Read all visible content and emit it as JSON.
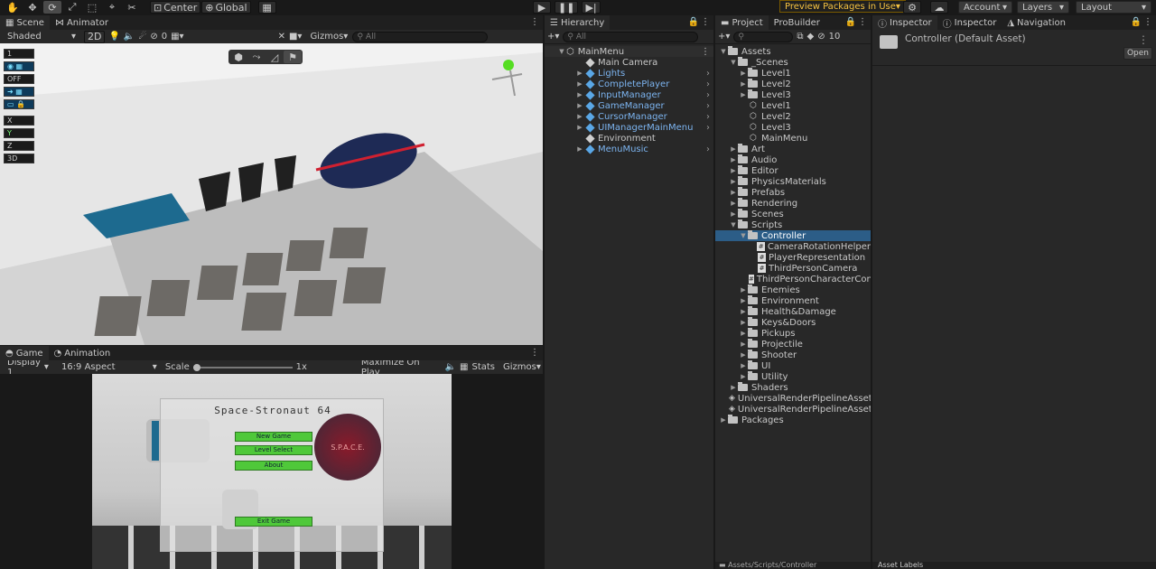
{
  "toolbar": {
    "center": "Center",
    "global": "Global",
    "preview": "Preview Packages in Use",
    "account": "Account",
    "layers": "Layers",
    "layout": "Layout"
  },
  "scene": {
    "tab_scene": "Scene",
    "tab_animator": "Animator",
    "shading": "Shaded",
    "mode2d": "2D",
    "hidden_count": "0",
    "gizmos": "Gizmos",
    "search_placeholder": "All",
    "overlays": [
      "1",
      "",
      "OFF",
      "",
      "",
      "X",
      "Y",
      "Z",
      "3D"
    ]
  },
  "game": {
    "tab_game": "Game",
    "tab_animation": "Animation",
    "display": "Display 1",
    "aspect": "16:9 Aspect",
    "scale_label": "Scale",
    "scale_value": "1x",
    "maximize": "Maximize On Play",
    "stats": "Stats",
    "gizmos": "Gizmos",
    "menu_title": "Space-Stronaut 64",
    "buttons": [
      "New Game",
      "Level Select",
      "About",
      "Exit Game"
    ],
    "logo_text": "S.P.A.C.E."
  },
  "hierarchy": {
    "tab": "Hierarchy",
    "search_placeholder": "All",
    "root": "MainMenu",
    "items": [
      {
        "name": "Main Camera",
        "blue": false,
        "arrow": false
      },
      {
        "name": "Lights",
        "blue": true,
        "arrow": true
      },
      {
        "name": "CompletePlayer",
        "blue": true,
        "arrow": true
      },
      {
        "name": "InputManager",
        "blue": true,
        "arrow": true
      },
      {
        "name": "GameManager",
        "blue": true,
        "arrow": true
      },
      {
        "name": "CursorManager",
        "blue": true,
        "arrow": true
      },
      {
        "name": "UIManagerMainMenu",
        "blue": true,
        "arrow": true
      },
      {
        "name": "Environment",
        "blue": false,
        "arrow": false
      },
      {
        "name": "MenuMusic",
        "blue": true,
        "arrow": true
      }
    ]
  },
  "project": {
    "tab_project": "Project",
    "tab_probuilder": "ProBuilder",
    "hidden_count": "10",
    "breadcrumb": "Assets/Scripts/Controller",
    "tree": [
      {
        "name": "Assets",
        "depth": 0,
        "type": "folder",
        "arrow": "open"
      },
      {
        "name": "_Scenes",
        "depth": 1,
        "type": "folder",
        "arrow": "open"
      },
      {
        "name": "Level1",
        "depth": 2,
        "type": "folder",
        "arrow": "closed"
      },
      {
        "name": "Level2",
        "depth": 2,
        "type": "folder",
        "arrow": "closed"
      },
      {
        "name": "Level3",
        "depth": 2,
        "type": "folder",
        "arrow": "closed"
      },
      {
        "name": "Level1",
        "depth": 2,
        "type": "scene",
        "arrow": "none"
      },
      {
        "name": "Level2",
        "depth": 2,
        "type": "scene",
        "arrow": "none"
      },
      {
        "name": "Level3",
        "depth": 2,
        "type": "scene",
        "arrow": "none"
      },
      {
        "name": "MainMenu",
        "depth": 2,
        "type": "scene",
        "arrow": "none"
      },
      {
        "name": "Art",
        "depth": 1,
        "type": "folder",
        "arrow": "closed"
      },
      {
        "name": "Audio",
        "depth": 1,
        "type": "folder",
        "arrow": "closed"
      },
      {
        "name": "Editor",
        "depth": 1,
        "type": "folder",
        "arrow": "closed"
      },
      {
        "name": "PhysicsMaterials",
        "depth": 1,
        "type": "folder",
        "arrow": "closed"
      },
      {
        "name": "Prefabs",
        "depth": 1,
        "type": "folder",
        "arrow": "closed"
      },
      {
        "name": "Rendering",
        "depth": 1,
        "type": "folder",
        "arrow": "closed"
      },
      {
        "name": "Scenes",
        "depth": 1,
        "type": "folder",
        "arrow": "closed"
      },
      {
        "name": "Scripts",
        "depth": 1,
        "type": "folder",
        "arrow": "open"
      },
      {
        "name": "Controller",
        "depth": 2,
        "type": "folder",
        "arrow": "open",
        "selected": true
      },
      {
        "name": "CameraRotationHelper",
        "depth": 3,
        "type": "script",
        "arrow": "none"
      },
      {
        "name": "PlayerRepresentation",
        "depth": 3,
        "type": "script",
        "arrow": "none"
      },
      {
        "name": "ThirdPersonCamera",
        "depth": 3,
        "type": "script",
        "arrow": "none"
      },
      {
        "name": "ThirdPersonCharacterCon",
        "depth": 3,
        "type": "script",
        "arrow": "none"
      },
      {
        "name": "Enemies",
        "depth": 2,
        "type": "folder",
        "arrow": "closed"
      },
      {
        "name": "Environment",
        "depth": 2,
        "type": "folder",
        "arrow": "closed"
      },
      {
        "name": "Health&Damage",
        "depth": 2,
        "type": "folder",
        "arrow": "closed"
      },
      {
        "name": "Keys&Doors",
        "depth": 2,
        "type": "folder",
        "arrow": "closed"
      },
      {
        "name": "Pickups",
        "depth": 2,
        "type": "folder",
        "arrow": "closed"
      },
      {
        "name": "Projectile",
        "depth": 2,
        "type": "folder",
        "arrow": "closed"
      },
      {
        "name": "Shooter",
        "depth": 2,
        "type": "folder",
        "arrow": "closed"
      },
      {
        "name": "UI",
        "depth": 2,
        "type": "folder",
        "arrow": "closed"
      },
      {
        "name": "Utility",
        "depth": 2,
        "type": "folder",
        "arrow": "closed"
      },
      {
        "name": "Shaders",
        "depth": 1,
        "type": "folder",
        "arrow": "closed"
      },
      {
        "name": "UniversalRenderPipelineAsset",
        "depth": 1,
        "type": "asset",
        "arrow": "none"
      },
      {
        "name": "UniversalRenderPipelineAsset_",
        "depth": 1,
        "type": "asset",
        "arrow": "none"
      },
      {
        "name": "Packages",
        "depth": 0,
        "type": "folder",
        "arrow": "closed"
      }
    ]
  },
  "inspector": {
    "tab1": "Inspector",
    "tab2": "Inspector",
    "tab3": "Navigation",
    "asset_title": "Controller (Default Asset)",
    "open_button": "Open",
    "asset_labels": "Asset Labels"
  }
}
